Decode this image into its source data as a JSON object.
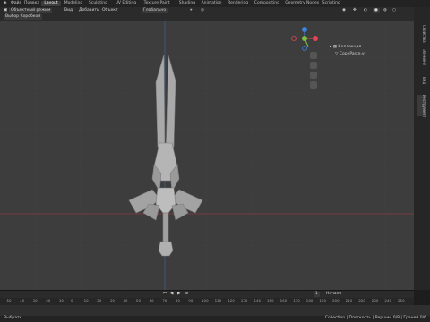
{
  "topbar": {
    "logo_menu": "Файл",
    "workspace_tabs": [
      "Правка",
      "Layout",
      "Modeling",
      "Sculpting",
      "UV Editing",
      "Texture Paint",
      "Shading",
      "Animation",
      "Rendering",
      "Compositing",
      "Geometry Nodes",
      "Scripting"
    ],
    "active_tab": "Layout"
  },
  "viewport_header": {
    "mode": "Объектный режим",
    "menus": [
      "Вид",
      "Добавить",
      "Объект"
    ],
    "transform": "Глобально",
    "viewport_label": "Выбор Коробкой"
  },
  "outliner": {
    "collection": "Коллекция",
    "object": "CopyPaste.vr"
  },
  "timeline": {
    "frame_label": "Кадр",
    "start_label": "Начало",
    "current_frame": "1",
    "ticks": [
      "-50",
      "-40",
      "-30",
      "-20",
      "-10",
      "0",
      "10",
      "20",
      "30",
      "40",
      "50",
      "60",
      "70",
      "80",
      "90",
      "100",
      "110",
      "120",
      "130",
      "140",
      "150",
      "160",
      "170",
      "180",
      "190",
      "200",
      "210",
      "220",
      "230",
      "240",
      "250"
    ]
  },
  "statusbar": {
    "left": "Выбрать",
    "right": "Collection | Плоскость | Вершин 0/8 | Граней 0/6"
  },
  "right_tabs": [
    "Свойства",
    "Элемент",
    "Вид",
    "Инструмент"
  ],
  "gizmo_colors": {
    "x": "#e54555",
    "y": "#7fbf3a",
    "z": "#3f82e0"
  }
}
